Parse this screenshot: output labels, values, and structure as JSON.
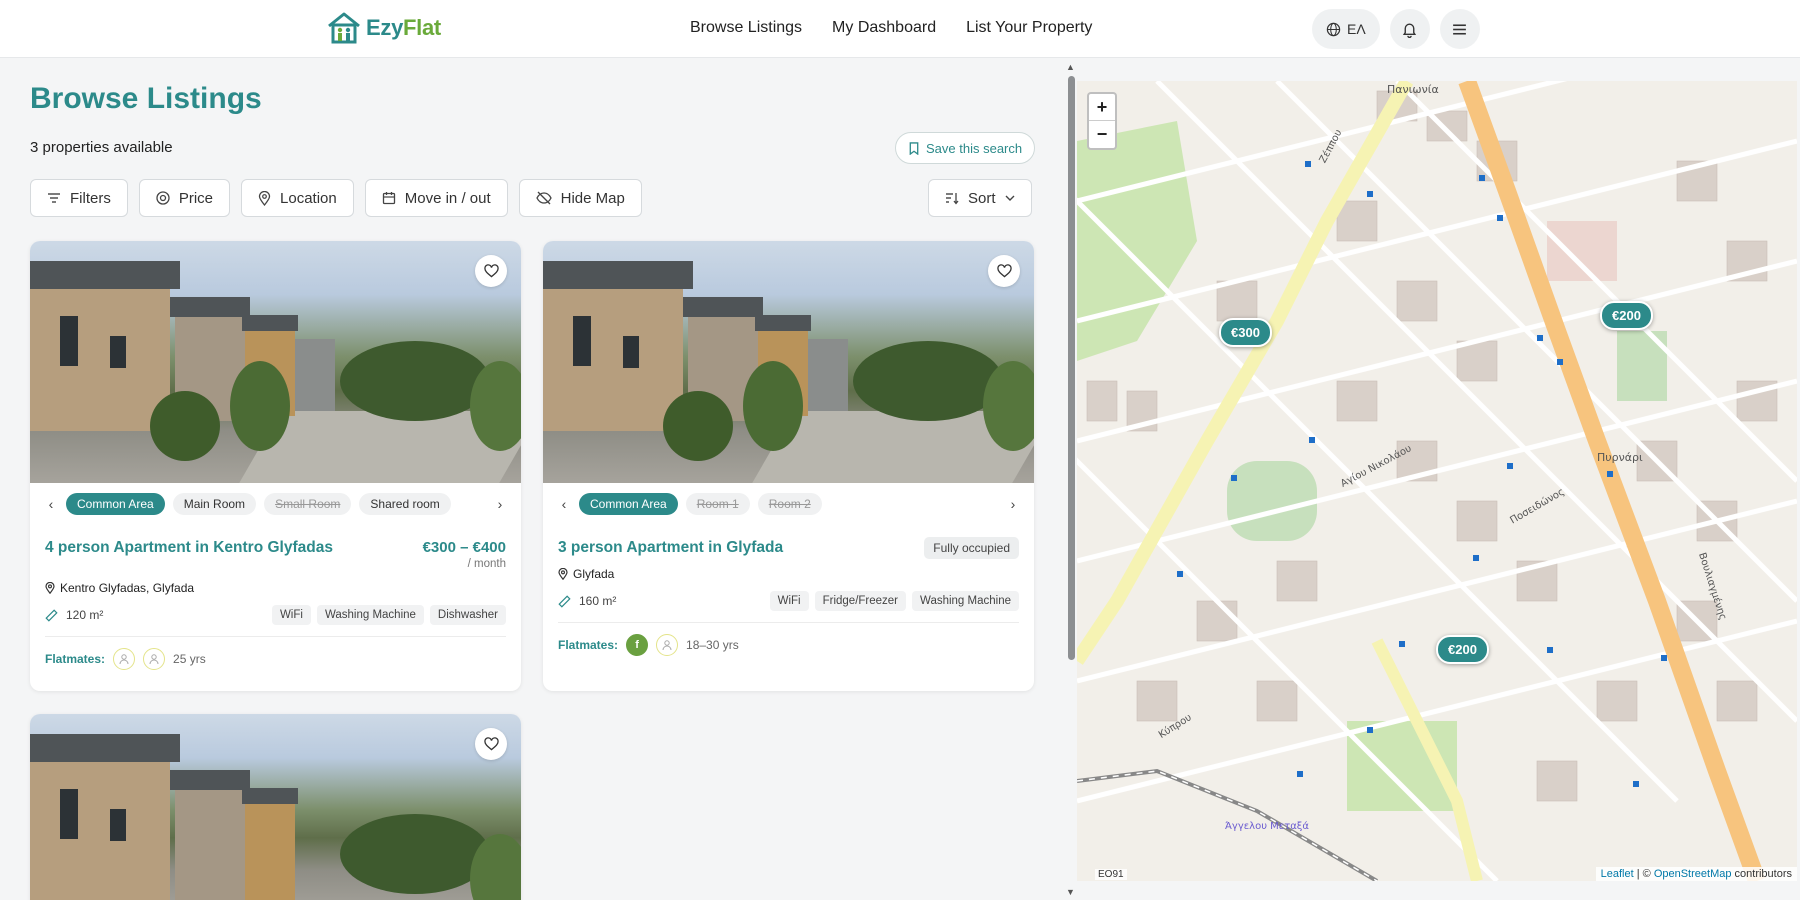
{
  "brand": {
    "name_part1": "Ezy",
    "name_part2": "Flat"
  },
  "nav": {
    "browse": "Browse Listings",
    "dashboard": "My Dashboard",
    "list_property": "List Your Property"
  },
  "header_right": {
    "language": "ΕΛ"
  },
  "page": {
    "title": "Browse Listings",
    "count": "3 properties available",
    "save_search": "Save this search"
  },
  "filters": {
    "filters": "Filters",
    "price": "Price",
    "location": "Location",
    "move": "Move in / out",
    "hide_map": "Hide Map",
    "sort": "Sort"
  },
  "listings": [
    {
      "title": "4 person Apartment in Kentro Glyfadas",
      "price": "€300 – €400",
      "period": "/ month",
      "location": "Kentro Glyfadas, Glyfada",
      "area": "120 m²",
      "amenities": [
        "WiFi",
        "Washing Machine",
        "Dishwasher"
      ],
      "rooms": [
        {
          "label": "Common Area",
          "state": "active"
        },
        {
          "label": "Main Room",
          "state": "normal"
        },
        {
          "label": "Small Room",
          "state": "locked"
        },
        {
          "label": "Shared room",
          "state": "normal"
        }
      ],
      "flatmates_label": "Flatmates:",
      "flatmates_age": "25 yrs"
    },
    {
      "title": "3 person Apartment in Glyfada",
      "status": "Fully occupied",
      "location": "Glyfada",
      "area": "160 m²",
      "amenities": [
        "WiFi",
        "Fridge/Freezer",
        "Washing Machine"
      ],
      "rooms": [
        {
          "label": "Common Area",
          "state": "active"
        },
        {
          "label": "Room 1",
          "state": "locked"
        },
        {
          "label": "Room 2",
          "state": "locked"
        }
      ],
      "flatmates_label": "Flatmates:",
      "flatmate_initial": "f",
      "flatmates_age": "18–30 yrs"
    }
  ],
  "map": {
    "zoom_in": "+",
    "zoom_out": "−",
    "pins": [
      "€300",
      "€200",
      "€200"
    ],
    "labels": [
      "Πυρνάρι",
      "Άγγελου Μεταξά",
      "Βουλιαγμένης",
      "Ζέππου",
      "Ποσειδώνος",
      "Αγίου Νικολάου",
      "Κύπρου",
      "Πανιωνία"
    ],
    "code": "ΕΟ91",
    "attribution": {
      "leaflet": "Leaflet",
      "sep": " | © ",
      "osm": "OpenStreetMap",
      "suffix": " contributors"
    }
  },
  "colors": {
    "accent": "#2c8a8a",
    "brand_green": "#6aaa3a"
  }
}
